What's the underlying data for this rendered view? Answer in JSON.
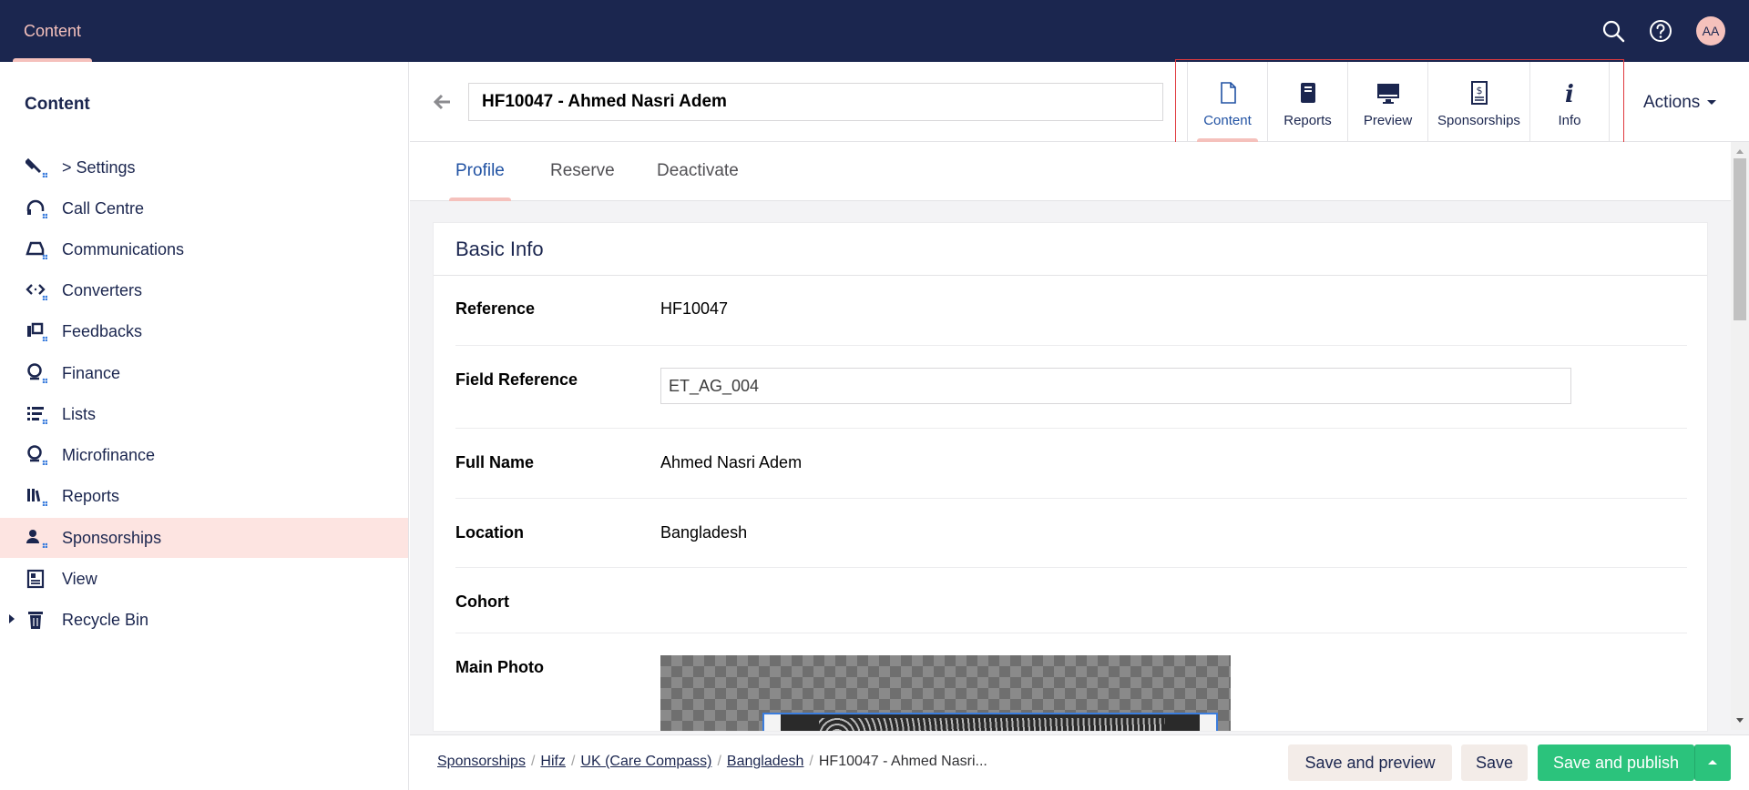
{
  "topbar": {
    "section": "Content",
    "avatar_initials": "AA",
    "icons": [
      "search-icon",
      "help-icon"
    ]
  },
  "sidebar": {
    "title": "Content",
    "items": [
      {
        "label": "> Settings",
        "icon": "wrench-icon"
      },
      {
        "label": "Call Centre",
        "icon": "headset-icon"
      },
      {
        "label": "Communications",
        "icon": "inbox-icon"
      },
      {
        "label": "Converters",
        "icon": "code-arrows-icon"
      },
      {
        "label": "Feedbacks",
        "icon": "briefcase-icon"
      },
      {
        "label": "Finance",
        "icon": "coin-icon"
      },
      {
        "label": "Lists",
        "icon": "list-icon"
      },
      {
        "label": "Microfinance",
        "icon": "coin-icon"
      },
      {
        "label": "Reports",
        "icon": "books-icon"
      },
      {
        "label": "Sponsorships",
        "icon": "user-dollar-icon",
        "active": true
      },
      {
        "label": "View",
        "icon": "newspaper-icon"
      },
      {
        "label": "Recycle Bin",
        "icon": "trash-icon"
      }
    ]
  },
  "header": {
    "node_name": "HF10047 - Ahmed Nasri Adem",
    "app_tabs": [
      {
        "label": "Content",
        "icon": "document-icon",
        "active": true
      },
      {
        "label": "Reports",
        "icon": "book-icon"
      },
      {
        "label": "Preview",
        "icon": "monitor-icon"
      },
      {
        "label": "Sponsorships",
        "icon": "receipt-dollar-icon"
      },
      {
        "label": "Info",
        "icon": "info-icon"
      }
    ],
    "actions_label": "Actions"
  },
  "subtabs": [
    {
      "label": "Profile",
      "active": true
    },
    {
      "label": "Reserve"
    },
    {
      "label": "Deactivate"
    }
  ],
  "panel": {
    "title": "Basic Info",
    "rows": [
      {
        "key": "Reference",
        "value": "HF10047"
      },
      {
        "key": "Field Reference",
        "value": "ET_AG_004"
      },
      {
        "key": "Full Name",
        "value": "Ahmed Nasri Adem"
      },
      {
        "key": "Location",
        "value": "Bangladesh"
      },
      {
        "key": "Cohort",
        "value": ""
      },
      {
        "key": "Main Photo",
        "value": ""
      }
    ]
  },
  "footer": {
    "breadcrumbs": [
      "Sponsorships",
      "Hifz",
      "UK (Care Compass)",
      "Bangladesh"
    ],
    "current": "HF10047 - Ahmed Nasri...",
    "buttons": {
      "save_preview": "Save and preview",
      "save": "Save",
      "save_publish": "Save and publish"
    }
  },
  "colors": {
    "topbar": "#1b264f",
    "accent": "#f5c1bc",
    "active_link": "#2152a3",
    "publish": "#2bc37c",
    "highlight_border": "#e0393e"
  }
}
